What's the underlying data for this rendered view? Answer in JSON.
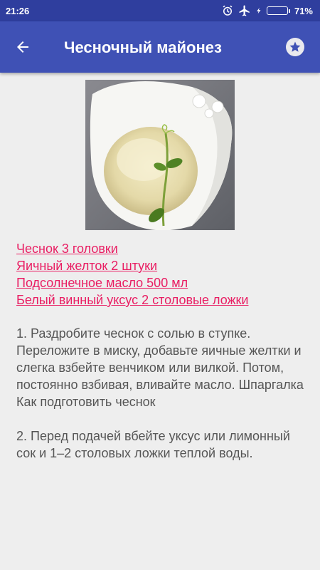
{
  "status_bar": {
    "time": "21:26",
    "battery_percent": "71%",
    "battery_level": 0.71,
    "icons": [
      "alarm-icon",
      "airplane-mode-icon",
      "charging-icon",
      "battery-icon"
    ]
  },
  "toolbar": {
    "title": "Чесночный майонез",
    "back_icon": "arrow-left-icon",
    "favorite_icon": "star-icon"
  },
  "recipe": {
    "ingredients": [
      "Чеснок 3 головки",
      "Яичный желток 2 штуки",
      "Подсолнечное масло 500 мл",
      "Белый винный уксус 2 столовые ложки"
    ],
    "steps": [
      "1. Раздробите чеснок с солью в ступке. Переложите в миску, добавьте яичные желтки и слегка взбейте венчиком или вилкой. Потом, постоянно взбивая, вливайте масло. Шпаргалка Как подготовить чеснок",
      "2. Перед подачей вбейте уксус или лимонный сок и 1–2 столовых ложки теплой воды."
    ]
  },
  "colors": {
    "status_bar": "#2f3e9e",
    "toolbar": "#3f51b5",
    "link": "#e91e63",
    "body_text": "#555555",
    "background": "#eeeeee"
  }
}
